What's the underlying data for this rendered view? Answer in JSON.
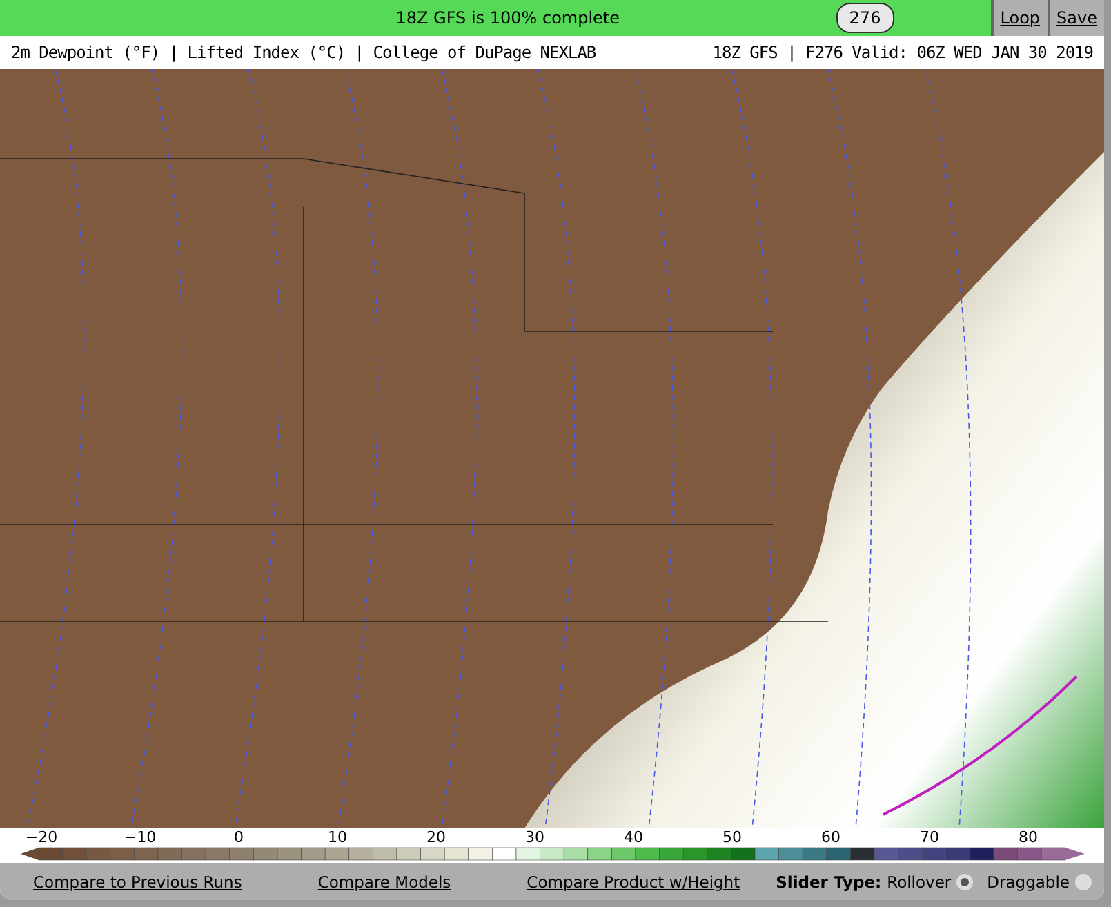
{
  "status_bar": {
    "message": "18Z GFS is 100% complete",
    "frame": "276",
    "links": [
      "Loop",
      "Save"
    ]
  },
  "map_header": {
    "title": "2m Dewpoint (°F) | Lifted Index (°C) | College of DuPage NEXLAB",
    "run_info": "18Z GFS | F276 Valid: 06Z WED JAN 30 2019"
  },
  "color_scale": {
    "ticks": [
      "−20",
      "−10",
      "0",
      "10",
      "20",
      "30",
      "40",
      "50",
      "60",
      "70",
      "80"
    ]
  },
  "footer": {
    "links": [
      "Compare to Previous Runs",
      "Compare Models",
      "Compare Product w/Height"
    ],
    "slider_type_label": "Slider Type:",
    "options": [
      {
        "label": "Rollover",
        "selected": true
      },
      {
        "label": "Draggable",
        "selected": false
      }
    ]
  }
}
